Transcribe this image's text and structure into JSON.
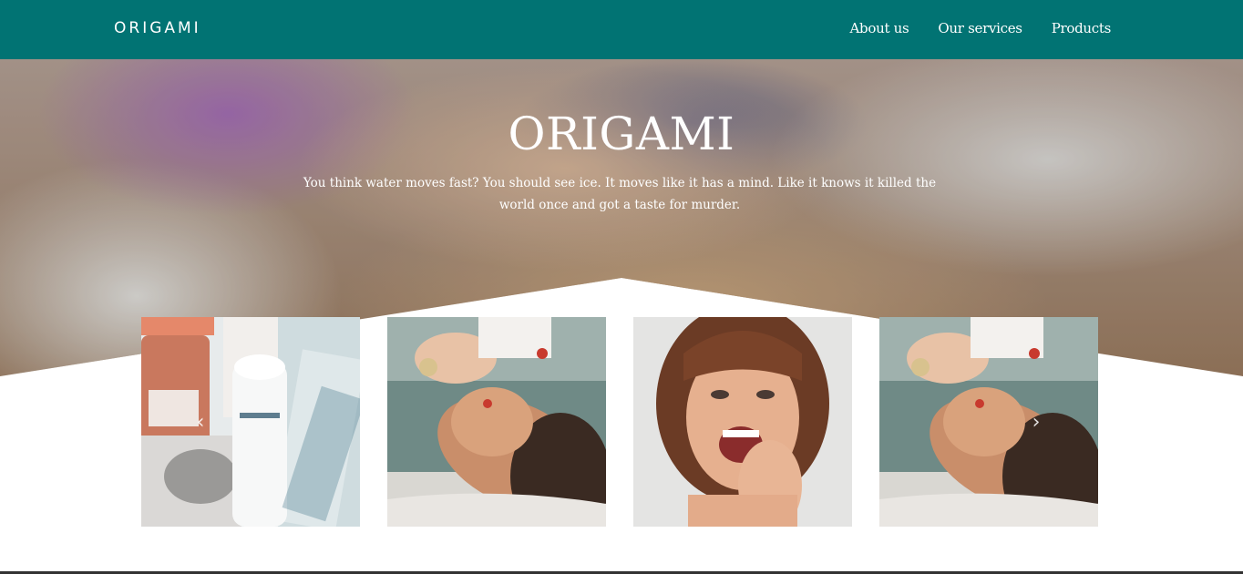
{
  "nav": {
    "brand": "ORIGAMI",
    "links": [
      "About us",
      "Our services",
      "Products"
    ]
  },
  "hero": {
    "title": "ORIGAMI",
    "text": "You think water moves fast? You should see ice. It moves like it has a mind. Like it knows it killed the world once and got a taste for murder."
  },
  "carousel": {
    "prev_icon": "chevron-left-icon",
    "next_icon": "chevron-right-icon",
    "prev_glyph": "‹",
    "next_glyph": "›"
  },
  "colors": {
    "nav_bg": "#017373",
    "text": "#ffffff"
  }
}
